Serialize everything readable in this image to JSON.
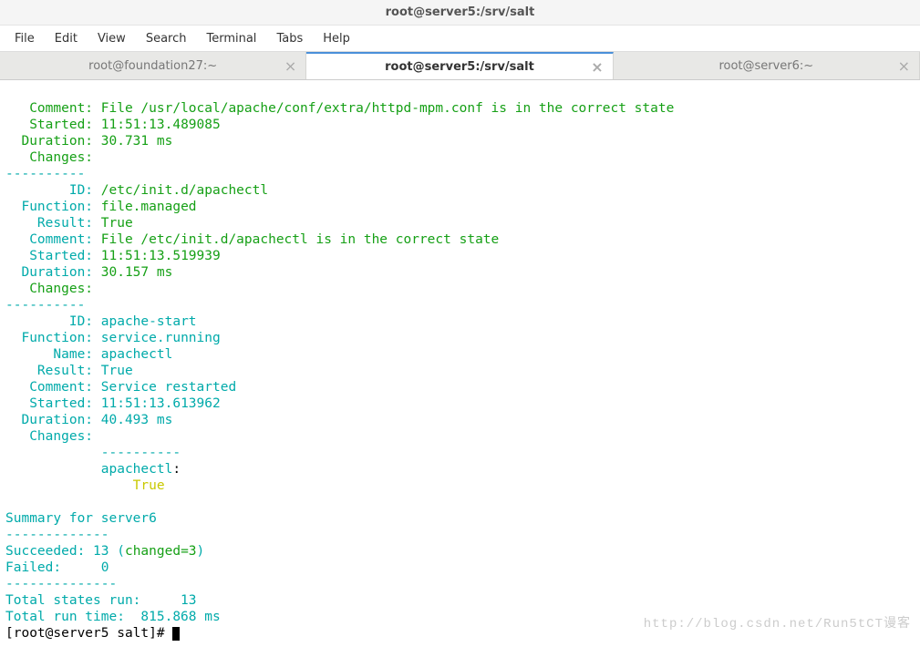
{
  "window": {
    "title": "root@server5:/srv/salt"
  },
  "menu": {
    "file": "File",
    "edit": "Edit",
    "view": "View",
    "search": "Search",
    "terminal": "Terminal",
    "tabs": "Tabs",
    "help": "Help"
  },
  "tabs": [
    {
      "label": "root@foundation27:~",
      "active": false
    },
    {
      "label": "root@server5:/srv/salt",
      "active": true
    },
    {
      "label": "root@server6:~",
      "active": false
    }
  ],
  "close_glyph": "×",
  "term": {
    "b1": {
      "comment_lbl": "   Comment: ",
      "comment_val": "File /usr/local/apache/conf/extra/httpd-mpm.conf is in the correct state",
      "started_lbl": "   Started: ",
      "started_val": "11:51:13.489085",
      "duration_lbl": "  Duration: ",
      "duration_val": "30.731 ms",
      "changes_lbl": "   Changes:"
    },
    "sep": "----------",
    "b2": {
      "id_lbl": "        ID: ",
      "id_val": "/etc/init.d/apachectl",
      "func_lbl": "  Function: ",
      "func_val": "file.managed",
      "result_lbl": "    Result: ",
      "result_val": "True",
      "comment_lbl": "   Comment: ",
      "comment_val": "File /etc/init.d/apachectl is in the correct state",
      "started_lbl": "   Started: ",
      "started_val": "11:51:13.519939",
      "duration_lbl": "  Duration: ",
      "duration_val": "30.157 ms",
      "changes_lbl": "   Changes:"
    },
    "b3": {
      "id_lbl": "        ID: ",
      "id_val": "apache-start",
      "func_lbl": "  Function: ",
      "func_val": "service.running",
      "name_lbl": "      Name: ",
      "name_val": "apachectl",
      "result_lbl": "    Result: ",
      "result_val": "True",
      "comment_lbl": "   Comment: ",
      "comment_val": "Service restarted",
      "started_lbl": "   Started: ",
      "started_val": "11:51:13.613962",
      "duration_lbl": "  Duration: ",
      "duration_val": "40.493 ms",
      "changes_lbl": "   Changes:",
      "changes_sep": "            ----------",
      "changes_key": "            apachectl",
      "changes_colon": ":",
      "changes_true": "                True"
    },
    "blank": "",
    "summary": "Summary for server6",
    "dash13": "-------------",
    "succ_lbl": "Succeeded: ",
    "succ_val": "13 ",
    "succ_paren_l": "(",
    "succ_changed": "changed=3",
    "succ_paren_r": ")",
    "fail_lbl": "Failed:     ",
    "fail_val": "0",
    "dash14": "--------------",
    "total_states": "Total states run:     13",
    "total_time": "Total run time:  815.868 ms",
    "prompt": "[root@server5 salt]# "
  },
  "watermark": "http://blog.csdn.net/Run5tCT谩客"
}
